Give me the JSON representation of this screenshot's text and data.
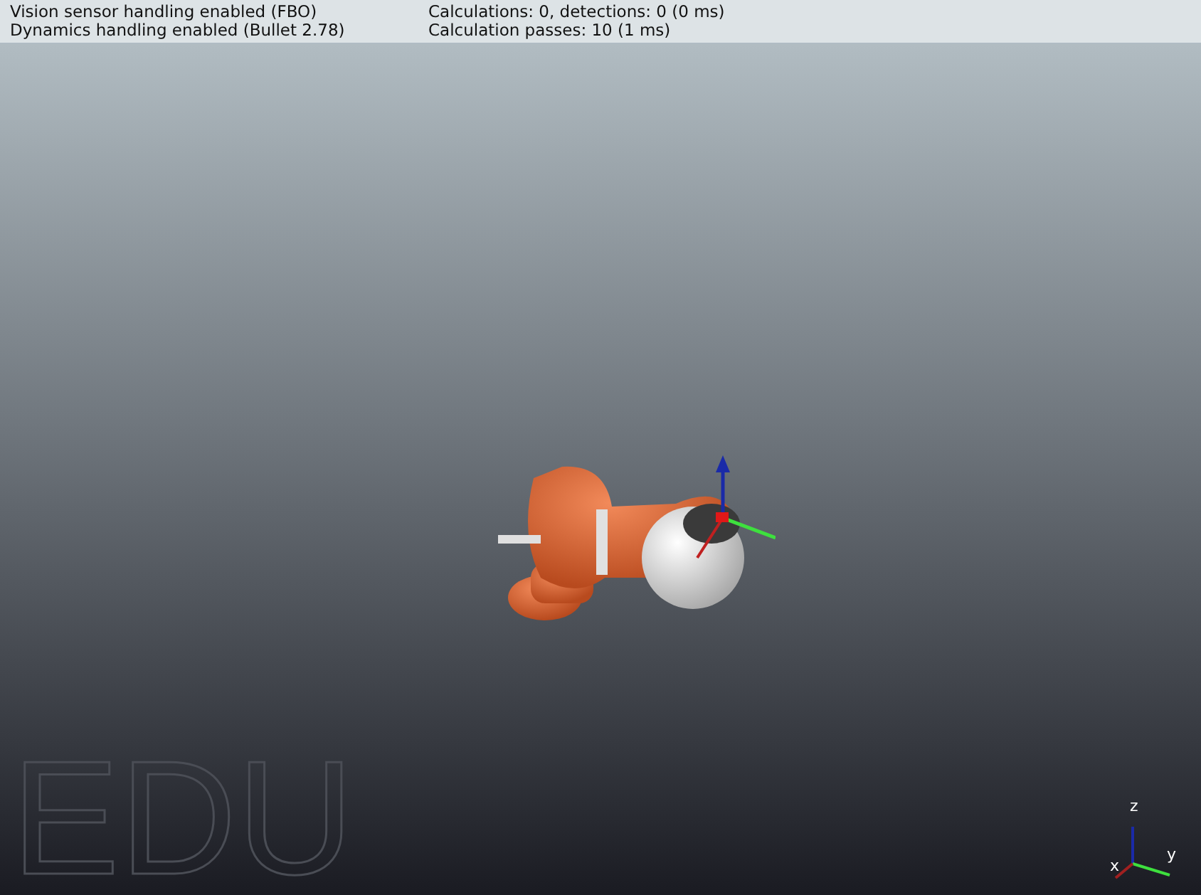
{
  "info_panel": {
    "rows": [
      {
        "left": "Vision sensor handling enabled (FBO)",
        "right": "Calculations: 0, detections: 0 (0 ms)"
      },
      {
        "left": "Dynamics handling enabled (Bullet 2.78)",
        "right": "Calculation passes: 10 (1 ms)"
      }
    ]
  },
  "scene": {
    "edition_mark": "EDU",
    "axes": {
      "x": "x",
      "y": "y",
      "z": "z"
    }
  }
}
